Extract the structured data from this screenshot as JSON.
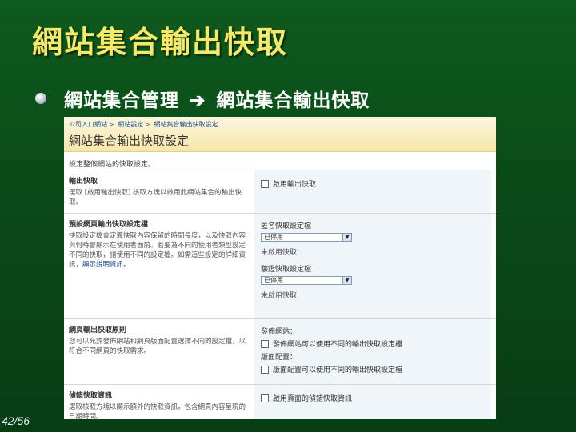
{
  "slide": {
    "title": "網站集合輸出快取",
    "bullet": {
      "left": "網站集合管理",
      "arrow": "➔",
      "right": "網站集合輸出快取"
    },
    "page_number": "42/56"
  },
  "screenshot": {
    "breadcrumb": [
      "公司入口網站",
      "網站設定",
      "網站集合輸出快取設定"
    ],
    "page_title": "網站集合輸出快取設定",
    "page_description": "設定整個網站的快取設定。",
    "sections": [
      {
        "title": "輸出快取",
        "description": "選取 [啟用輸出快取] 核取方塊以啟用此網站集合的輸出快取。",
        "controls": [
          {
            "type": "checkbox",
            "label": "啟用輸出快取"
          }
        ]
      },
      {
        "title": "預設網頁輸出快取設定檔",
        "description": "快取設定檔會定義快取內容保留的時間長度，以及快取內容與何時會顯示在使用者面前。若要為不同的使用者類型設定不同的快取，請使用不同的設定檔。如需這些設定的詳細資訊，",
        "link": "顯示說明資訊。",
        "controls": [
          {
            "type": "label",
            "text": "匿名快取設定檔"
          },
          {
            "type": "select",
            "value": "已停用"
          },
          {
            "type": "note",
            "text": "未啟用快取"
          },
          {
            "type": "label",
            "text": "驗證快取設定檔"
          },
          {
            "type": "select",
            "value": "已停用"
          },
          {
            "type": "note",
            "text": "未啟用快取"
          }
        ]
      },
      {
        "title": "網頁輸出快取原則",
        "description": "您可以允許發佈網站和網頁版面配置選擇不同的設定檔，以符合不同網頁的快取需求。",
        "controls": [
          {
            "type": "label",
            "text": "發佈網站："
          },
          {
            "type": "checkbox",
            "label": "發佈網站可以使用不同的輸出快取設定檔"
          },
          {
            "type": "label",
            "text": "版面配置："
          },
          {
            "type": "checkbox",
            "label": "版面配置可以使用不同的輸出快取設定檔"
          }
        ]
      },
      {
        "title": "偵錯快取資訊",
        "description": "選取核取方塊以顯示額外的快取資訊，包含網頁內容呈現的日期時間。",
        "controls": [
          {
            "type": "checkbox",
            "label": "啟用頁面的偵錯快取資訊"
          }
        ]
      }
    ]
  }
}
